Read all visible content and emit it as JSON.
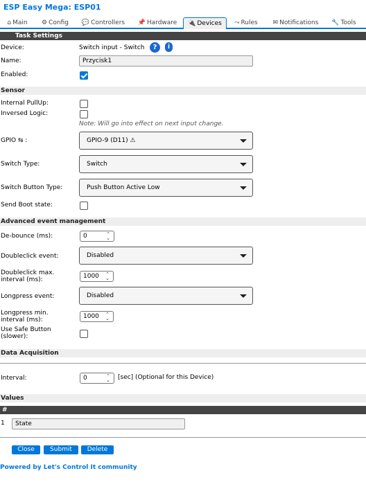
{
  "app": {
    "title": "ESP Easy Mega: ESP01"
  },
  "tabs": [
    {
      "icon": "⌂",
      "label": "Main"
    },
    {
      "icon": "⚙",
      "label": "Config"
    },
    {
      "icon": "💬",
      "label": "Controllers"
    },
    {
      "icon": "📌",
      "label": "Hardware"
    },
    {
      "icon": "🔌",
      "label": "Devices"
    },
    {
      "icon": "⤳",
      "label": "Rules"
    },
    {
      "icon": "✉",
      "label": "Notifications"
    },
    {
      "icon": "🔧",
      "label": "Tools"
    }
  ],
  "task_settings": {
    "header": "Task Settings",
    "device_label": "Device:",
    "device_value": "Switch input - Switch",
    "help_icon": "?",
    "info_icon": "i",
    "name_label": "Name:",
    "name_value": "Przycisk1",
    "enabled_label": "Enabled:",
    "enabled": true
  },
  "sensor": {
    "header": "Sensor",
    "pullup_label": "Internal PullUp:",
    "inversed_label": "Inversed Logic:",
    "note": "Note: Will go into effect on next input change.",
    "gpio_label": "GPIO ⇆ :",
    "gpio_value": "GPIO-9 (D11) ⚠",
    "switch_type_label": "Switch Type:",
    "switch_type_value": "Switch",
    "switch_button_label": "Switch Button Type:",
    "switch_button_value": "Push Button Active Low",
    "boot_label": "Send Boot state:"
  },
  "advanced": {
    "header": "Advanced event management",
    "debounce_label": "De-bounce (ms):",
    "debounce_value": "0",
    "doubleclick_label": "Doubleclick event:",
    "doubleclick_value": "Disabled",
    "doubleclick_max_label_1": "Doubleclick max.",
    "doubleclick_max_label_2": "interval (ms):",
    "doubleclick_max_value": "1000",
    "longpress_label": "Longpress event:",
    "longpress_value": "Disabled",
    "longpress_min_label_1": "Longpress min.",
    "longpress_min_label_2": "interval (ms):",
    "longpress_min_value": "1000",
    "safe_label_1": "Use Safe Button",
    "safe_label_2": "(slower):"
  },
  "acquisition": {
    "header": "Data Acquisition",
    "interval_label": "Interval:",
    "interval_value": "0",
    "interval_note": "[sec] (Optional for this Device)"
  },
  "values": {
    "header": "Values",
    "col_header": "#",
    "row_index": "1",
    "row_value": "State"
  },
  "buttons": {
    "close": "Close",
    "submit": "Submit",
    "delete": "Delete"
  },
  "footer": {
    "prefix": "Powered by ",
    "link": "Let's Control It",
    "suffix": " community"
  },
  "colors": {
    "accent": "#0077dd",
    "header_dark": "#444444",
    "header_light": "#eeeeee"
  }
}
